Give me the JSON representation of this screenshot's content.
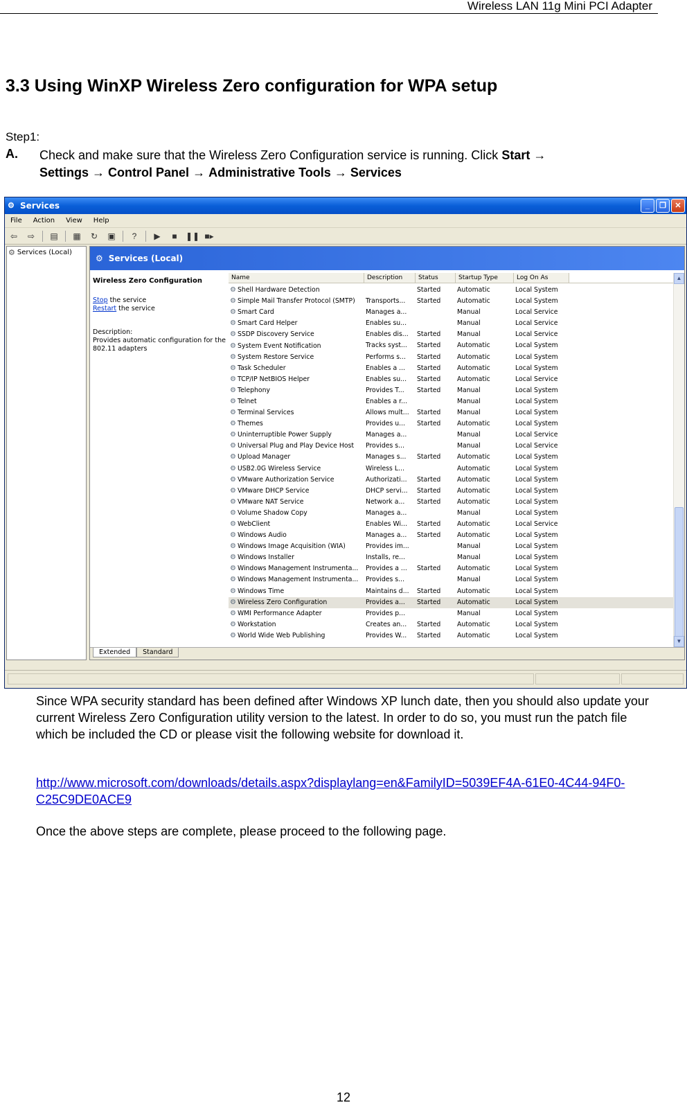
{
  "header": {
    "title": "Wireless LAN 11g Mini PCI Adapter"
  },
  "section_title": "3.3 Using WinXP Wireless Zero configuration for WPA setup",
  "step_label": "Step1:",
  "step_a": {
    "letter": "A.",
    "text": "Check and make sure that the Wireless Zero Configuration service is running. Click",
    "path": [
      "Start",
      "Settings",
      "Control Panel",
      "Administrative Tools",
      "Services"
    ],
    "arrow": "→"
  },
  "window": {
    "title": "Services",
    "menu": [
      "File",
      "Action",
      "View",
      "Help"
    ],
    "tree_root": "Services (Local)",
    "pane_title": "Services (Local)",
    "selected_service": {
      "name": "Wireless Zero Configuration",
      "stop_link": "Stop",
      "stop_text": " the service",
      "restart_link": "Restart",
      "restart_text": " the service",
      "description_label": "Description:",
      "description_text": "Provides automatic configuration for the 802.11 adapters"
    },
    "columns": [
      "Name",
      "Description",
      "Status",
      "Startup Type",
      "Log On As"
    ],
    "services": [
      {
        "name": "Shell Hardware Detection",
        "desc": "",
        "status": "Started",
        "startup": "Automatic",
        "logon": "Local System"
      },
      {
        "name": "Simple Mail Transfer Protocol (SMTP)",
        "desc": "Transports...",
        "status": "Started",
        "startup": "Automatic",
        "logon": "Local System"
      },
      {
        "name": "Smart Card",
        "desc": "Manages a...",
        "status": "",
        "startup": "Manual",
        "logon": "Local Service"
      },
      {
        "name": "Smart Card Helper",
        "desc": "Enables su...",
        "status": "",
        "startup": "Manual",
        "logon": "Local Service"
      },
      {
        "name": "SSDP Discovery Service",
        "desc": "Enables dis...",
        "status": "Started",
        "startup": "Manual",
        "logon": "Local Service"
      },
      {
        "name": "System Event Notification",
        "desc": "Tracks syst...",
        "status": "Started",
        "startup": "Automatic",
        "logon": "Local System"
      },
      {
        "name": "System Restore Service",
        "desc": "Performs s...",
        "status": "Started",
        "startup": "Automatic",
        "logon": "Local System"
      },
      {
        "name": "Task Scheduler",
        "desc": "Enables a ...",
        "status": "Started",
        "startup": "Automatic",
        "logon": "Local System"
      },
      {
        "name": "TCP/IP NetBIOS Helper",
        "desc": "Enables su...",
        "status": "Started",
        "startup": "Automatic",
        "logon": "Local Service"
      },
      {
        "name": "Telephony",
        "desc": "Provides T...",
        "status": "Started",
        "startup": "Manual",
        "logon": "Local System"
      },
      {
        "name": "Telnet",
        "desc": "Enables a r...",
        "status": "",
        "startup": "Manual",
        "logon": "Local System"
      },
      {
        "name": "Terminal Services",
        "desc": "Allows mult...",
        "status": "Started",
        "startup": "Manual",
        "logon": "Local System"
      },
      {
        "name": "Themes",
        "desc": "Provides u...",
        "status": "Started",
        "startup": "Automatic",
        "logon": "Local System"
      },
      {
        "name": "Uninterruptible Power Supply",
        "desc": "Manages a...",
        "status": "",
        "startup": "Manual",
        "logon": "Local Service"
      },
      {
        "name": "Universal Plug and Play Device Host",
        "desc": "Provides s...",
        "status": "",
        "startup": "Manual",
        "logon": "Local Service"
      },
      {
        "name": "Upload Manager",
        "desc": "Manages s...",
        "status": "Started",
        "startup": "Automatic",
        "logon": "Local System"
      },
      {
        "name": "USB2.0G Wireless Service",
        "desc": "Wireless L...",
        "status": "",
        "startup": "Automatic",
        "logon": "Local System"
      },
      {
        "name": "VMware Authorization Service",
        "desc": "Authorizati...",
        "status": "Started",
        "startup": "Automatic",
        "logon": "Local System"
      },
      {
        "name": "VMware DHCP Service",
        "desc": "DHCP servi...",
        "status": "Started",
        "startup": "Automatic",
        "logon": "Local System"
      },
      {
        "name": "VMware NAT Service",
        "desc": "Network a...",
        "status": "Started",
        "startup": "Automatic",
        "logon": "Local System"
      },
      {
        "name": "Volume Shadow Copy",
        "desc": "Manages a...",
        "status": "",
        "startup": "Manual",
        "logon": "Local System"
      },
      {
        "name": "WebClient",
        "desc": "Enables Wi...",
        "status": "Started",
        "startup": "Automatic",
        "logon": "Local Service"
      },
      {
        "name": "Windows Audio",
        "desc": "Manages a...",
        "status": "Started",
        "startup": "Automatic",
        "logon": "Local System"
      },
      {
        "name": "Windows Image Acquisition (WIA)",
        "desc": "Provides im...",
        "status": "",
        "startup": "Manual",
        "logon": "Local System"
      },
      {
        "name": "Windows Installer",
        "desc": "Installs, re...",
        "status": "",
        "startup": "Manual",
        "logon": "Local System"
      },
      {
        "name": "Windows Management Instrumenta...",
        "desc": "Provides a ...",
        "status": "Started",
        "startup": "Automatic",
        "logon": "Local System"
      },
      {
        "name": "Windows Management Instrumenta...",
        "desc": "Provides s...",
        "status": "",
        "startup": "Manual",
        "logon": "Local System"
      },
      {
        "name": "Windows Time",
        "desc": "Maintains d...",
        "status": "Started",
        "startup": "Automatic",
        "logon": "Local System"
      },
      {
        "name": "Wireless Zero Configuration",
        "desc": "Provides a...",
        "status": "Started",
        "startup": "Automatic",
        "logon": "Local System",
        "selected": true
      },
      {
        "name": "WMI Performance Adapter",
        "desc": "Provides p...",
        "status": "",
        "startup": "Manual",
        "logon": "Local System"
      },
      {
        "name": "Workstation",
        "desc": "Creates an...",
        "status": "Started",
        "startup": "Automatic",
        "logon": "Local System"
      },
      {
        "name": "World Wide Web Publishing",
        "desc": "Provides W...",
        "status": "Started",
        "startup": "Automatic",
        "logon": "Local System"
      }
    ],
    "tabs": [
      "Extended",
      "Standard"
    ]
  },
  "paragraph1": "Since WPA security standard has been defined after Windows XP lunch date, then you should also update your current Wireless Zero Configuration utility version to the latest. In order to do so, you must run the patch file which be included the CD or please visit the following website for download it.",
  "link": "http://www.microsoft.com/downloads/details.aspx?displaylang=en&FamilyID=5039EF4A-61E0-4C44-94F0-C25C9DE0ACE9",
  "paragraph2": "Once the above steps are complete, please proceed to the following page.",
  "page_number": "12",
  "colors": {
    "link": "#0000cc",
    "xp_title": "#0a5fd8",
    "pane_header": "#2a64d8"
  }
}
